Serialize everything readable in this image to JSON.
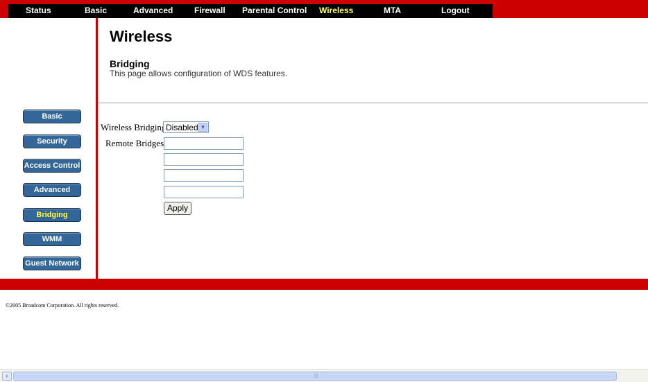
{
  "nav": {
    "items": [
      {
        "label": "Status"
      },
      {
        "label": "Basic"
      },
      {
        "label": "Advanced"
      },
      {
        "label": "Firewall"
      },
      {
        "label": "Parental Control"
      },
      {
        "label": "Wireless"
      },
      {
        "label": "MTA"
      },
      {
        "label": "Logout"
      }
    ],
    "active": "Wireless",
    "active_color": "#ffff66",
    "bar_color": "#cc0000"
  },
  "page": {
    "title": "Wireless",
    "section_title": "Bridging",
    "section_description": "This page allows configuration of WDS features."
  },
  "sidebar": {
    "items": [
      {
        "label": "Basic"
      },
      {
        "label": "Security"
      },
      {
        "label": "Access Control"
      },
      {
        "label": "Advanced"
      },
      {
        "label": "Bridging"
      },
      {
        "label": "WMM"
      },
      {
        "label": "Guest Network"
      }
    ],
    "active": "Bridging",
    "button_color": "#336699"
  },
  "form": {
    "wireless_bridging_label": "Wireless Bridging",
    "wireless_bridging_value": "Disabled",
    "remote_bridges_label": "Remote Bridges",
    "remote_bridges": [
      "",
      "",
      "",
      ""
    ],
    "apply_label": "Apply"
  },
  "footer": {
    "copyright": "©2005 Broadcom Corporation. All rights reserved."
  }
}
